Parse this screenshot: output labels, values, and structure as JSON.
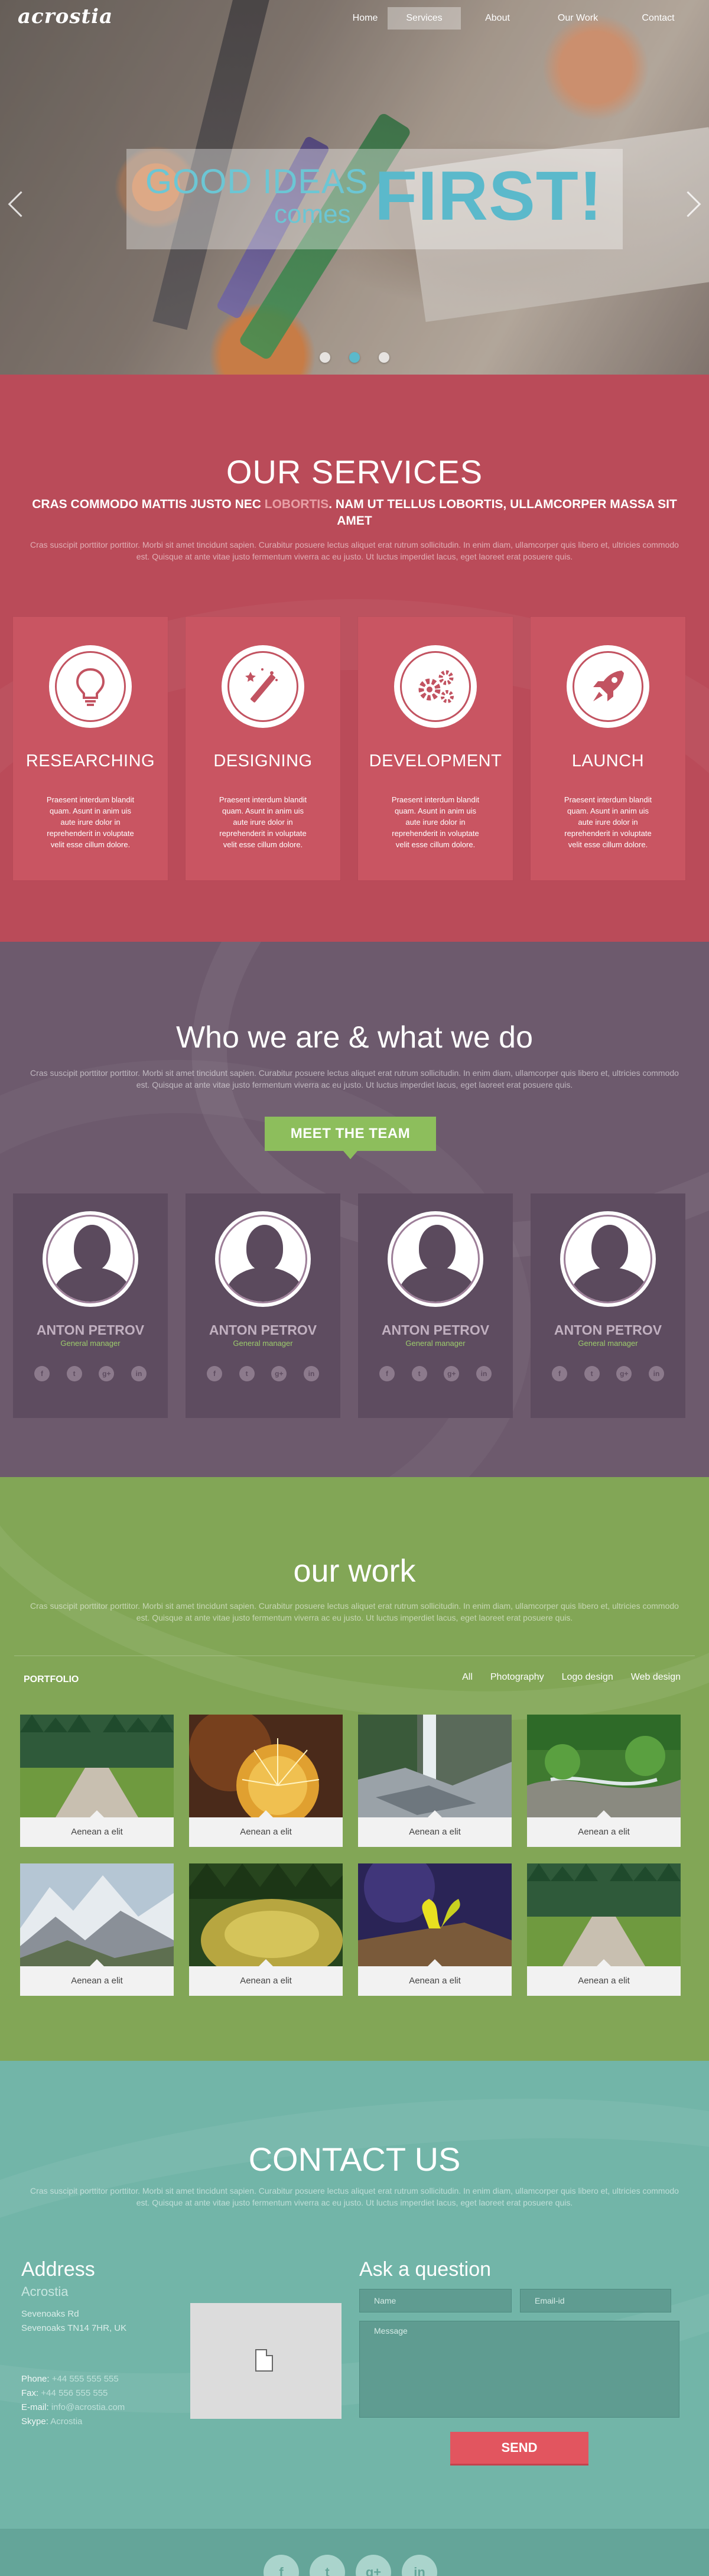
{
  "brand": {
    "logo": "acrostia"
  },
  "nav": {
    "items": [
      {
        "label": "Home",
        "active": false
      },
      {
        "label": "Services",
        "active": true
      },
      {
        "label": "About",
        "active": false
      },
      {
        "label": "Our Work",
        "active": false
      },
      {
        "label": "Contact",
        "active": false
      }
    ]
  },
  "hero": {
    "line1": "GOOD IDEAS",
    "line2": "comes",
    "line3": "FIRST!",
    "slide_count": 3,
    "active_slide": 2
  },
  "lorem": "Cras suscipit porttitor porttitor. Morbi sit amet tincidunt sapien. Curabitur posuere lectus aliquet erat rutrum sollicitudin. In enim diam, ullamcorper quis libero et, ultricies commodo est. Quisque at ante vitae justo fermentum viverra ac eu justo. Ut luctus imperdiet lacus, eget laoreet erat posuere quis.",
  "services": {
    "title": "OUR SERVICES",
    "sub_a": "CRAS COMMODO MATTIS JUSTO NEC ",
    "sub_highlight": "LOBORTIS",
    "sub_b": ". NAM UT TELLUS LOBORTIS, ULLAMCORPER MASSA SIT AMET",
    "lead": "Cras suscipit porttitor porttitor. Morbi sit amet tincidunt sapien. Curabitur posuere lectus aliquet erat rutrum sollicitudin. In enim diam, ullamcorper quis libero et, ultricies commodo est. Quisque at ante vitae justo fermentum viverra ac eu justo. Ut luctus imperdiet lacus, eget laoreet erat posuere quis.",
    "cards": [
      {
        "name": "RESEARCHING",
        "icon": "lightbulb-icon",
        "text": "Praesent interdum blandit quam. Asunt in anim uis aute irure dolor in reprehenderit in voluptate velit esse cillum dolore."
      },
      {
        "name": "DESIGNING",
        "icon": "magic-wand-icon",
        "text": "Praesent interdum blandit quam. Asunt in anim uis aute irure dolor in reprehenderit in voluptate velit esse cillum dolore."
      },
      {
        "name": "DEVELOPMENT",
        "icon": "gears-icon",
        "text": "Praesent interdum blandit quam. Asunt in anim uis aute irure dolor in reprehenderit in voluptate velit esse cillum dolore."
      },
      {
        "name": "LAUNCH",
        "icon": "rocket-icon",
        "text": "Praesent interdum blandit quam. Asunt in anim uis aute irure dolor in reprehenderit in voluptate velit esse cillum dolore."
      }
    ]
  },
  "team": {
    "title": "Who we are & what we do",
    "lead": "Cras suscipit porttitor porttitor. Morbi sit amet tincidunt sapien. Curabitur posuere lectus aliquet erat rutrum sollicitudin. In enim diam, ullamcorper quis libero et, ultricies commodo est. Quisque at ante vitae justo fermentum viverra ac eu justo. Ut luctus imperdiet lacus, eget laoreet erat posuere quis.",
    "button": "MEET THE TEAM",
    "members": [
      {
        "name": "ANTON PETROV",
        "role": "General manager"
      },
      {
        "name": "ANTON PETROV",
        "role": "General manager"
      },
      {
        "name": "ANTON PETROV",
        "role": "General manager"
      },
      {
        "name": "ANTON PETROV",
        "role": "General manager"
      }
    ],
    "social": [
      {
        "icon": "facebook-icon",
        "glyph": "f"
      },
      {
        "icon": "twitter-icon",
        "glyph": "t"
      },
      {
        "icon": "google-plus-icon",
        "glyph": "g+"
      },
      {
        "icon": "linkedin-icon",
        "glyph": "in"
      }
    ]
  },
  "work": {
    "title": "our work",
    "lead": "Cras suscipit porttitor porttitor. Morbi sit amet tincidunt sapien. Curabitur posuere lectus aliquet erat rutrum sollicitudin. In enim diam, ullamcorper quis libero et, ultricies commodo est. Quisque at ante vitae justo fermentum viverra ac eu justo. Ut luctus imperdiet lacus, eget laoreet erat posuere quis.",
    "portfolio_label": "PORTFOLIO",
    "filters": [
      "All",
      "Photography",
      "Logo design",
      "Web design"
    ],
    "items": [
      {
        "caption": "Aenean a elit",
        "scene": "forest-path"
      },
      {
        "caption": "Aenean a elit",
        "scene": "cactus"
      },
      {
        "caption": "Aenean a elit",
        "scene": "waterfall"
      },
      {
        "caption": "Aenean a elit",
        "scene": "green-river"
      },
      {
        "caption": "Aenean a elit",
        "scene": "mountains"
      },
      {
        "caption": "Aenean a elit",
        "scene": "mossy-rock"
      },
      {
        "caption": "Aenean a elit",
        "scene": "plant-sky"
      },
      {
        "caption": "Aenean a elit",
        "scene": "forest-path"
      }
    ]
  },
  "contact": {
    "title": "CONTACT US",
    "lead": "Cras suscipit porttitor porttitor. Morbi sit amet tincidunt sapien. Curabitur posuere lectus aliquet erat rutrum sollicitudin. In enim diam, ullamcorper quis libero et, ultricies commodo est. Quisque at ante vitae justo fermentum viverra ac eu justo. Ut luctus imperdiet lacus, eget laoreet erat posuere quis.",
    "address_title": "Address",
    "company": "Acrostia",
    "street": "Sevenoaks Rd",
    "city": "Sevenoaks TN14 7HR, UK",
    "phone_label": "Phone:",
    "phone": "+44 555 555 555",
    "fax_label": "Fax:",
    "fax": "+44 556 555 555",
    "email_label": "E-mail:",
    "email": "info@acrostia.com",
    "skype_label": "Skype:",
    "skype": "Acrostia",
    "ask_title": "Ask a question",
    "name_placeholder": "Name",
    "email_placeholder": "Email-id",
    "message_placeholder": "Message",
    "send": "SEND"
  },
  "footer": {
    "social": [
      {
        "icon": "facebook-icon",
        "glyph": "f"
      },
      {
        "icon": "twitter-icon",
        "glyph": "t"
      },
      {
        "icon": "google-plus-icon",
        "glyph": "g+"
      },
      {
        "icon": "linkedin-icon",
        "glyph": "in"
      }
    ]
  }
}
